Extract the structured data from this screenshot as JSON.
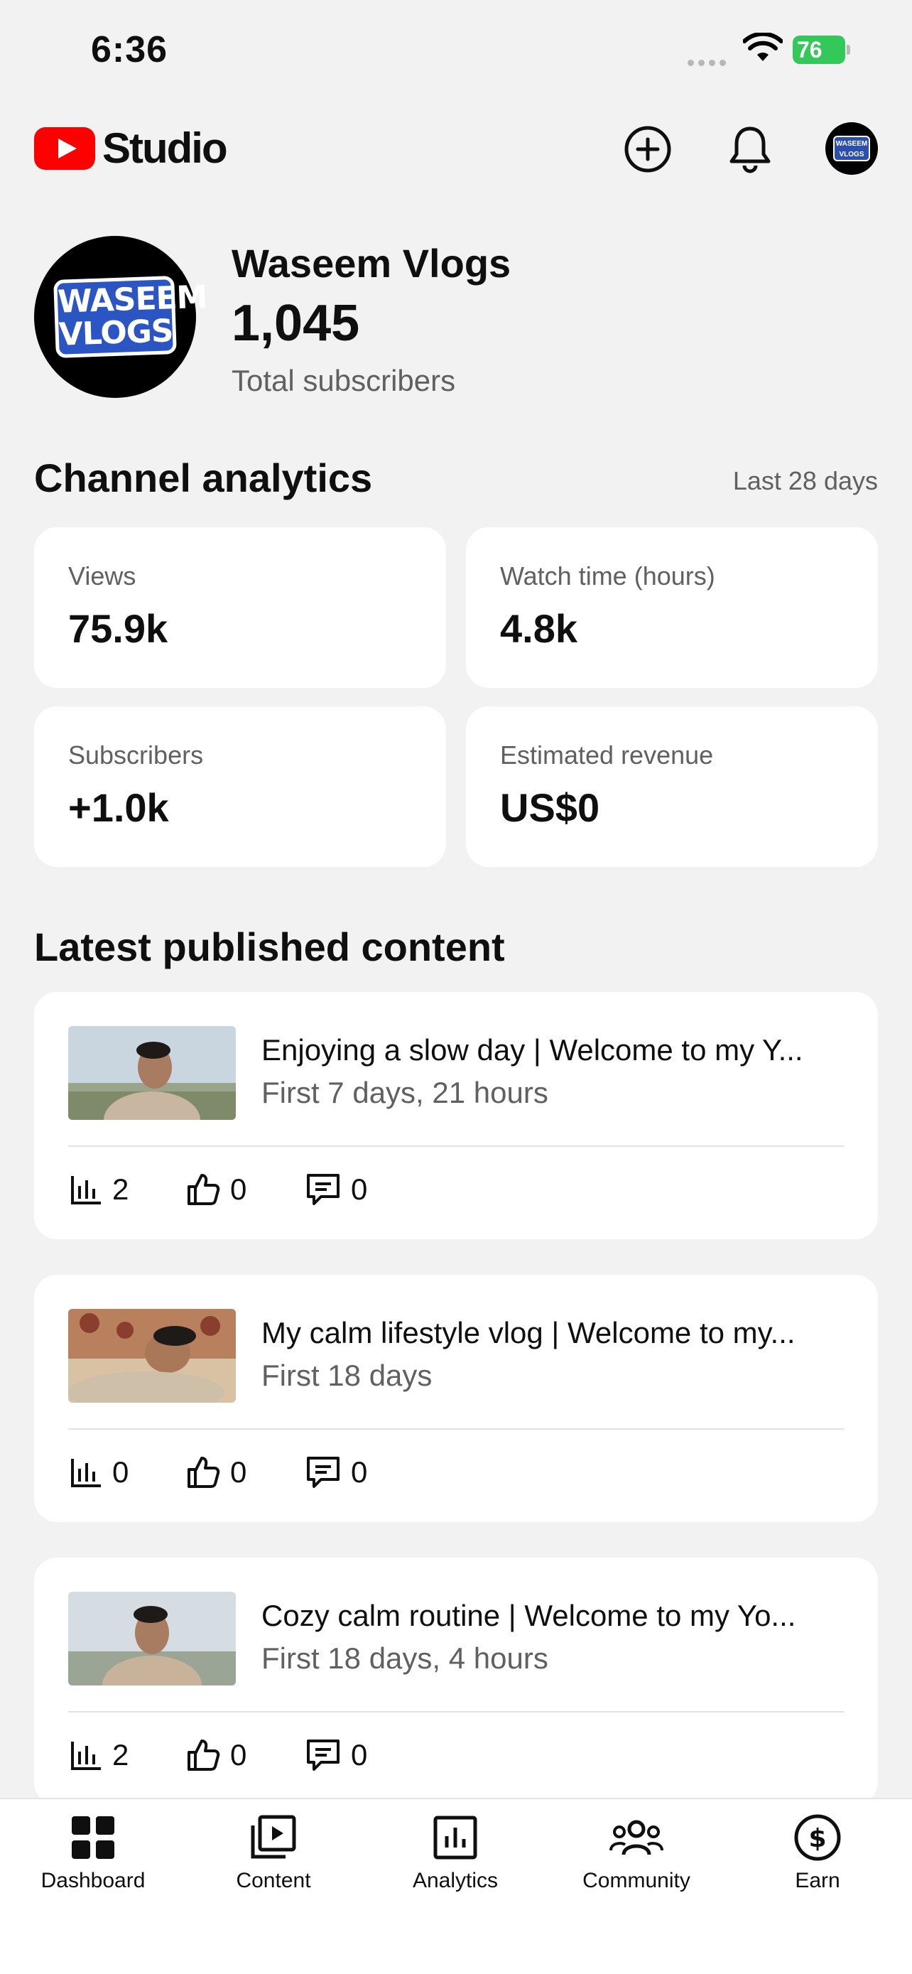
{
  "status": {
    "time": "6:36",
    "battery": "76"
  },
  "header": {
    "logo_text": "Studio",
    "avatar_text": "WASEEM VLOGS"
  },
  "channel": {
    "name": "Waseem Vlogs",
    "subscriber_count": "1,045",
    "subscriber_label": "Total subscribers",
    "avatar_line1": "WASEEM",
    "avatar_line2": "VLOGS"
  },
  "analytics": {
    "title": "Channel analytics",
    "range": "Last 28 days",
    "cards": [
      {
        "label": "Views",
        "value": "75.9k"
      },
      {
        "label": "Watch time (hours)",
        "value": "4.8k"
      },
      {
        "label": "Subscribers",
        "value": "+1.0k"
      },
      {
        "label": "Estimated revenue",
        "value": "US$0"
      }
    ]
  },
  "latest": {
    "title": "Latest published content",
    "items": [
      {
        "title": "Enjoying a slow day | Welcome to my Y...",
        "subtitle": "First 7 days, 21 hours",
        "views": "2",
        "likes": "0",
        "comments": "0"
      },
      {
        "title": "My calm lifestyle vlog | Welcome to my...",
        "subtitle": "First 18 days",
        "views": "0",
        "likes": "0",
        "comments": "0"
      },
      {
        "title": "Cozy calm routine | Welcome to my Yo...",
        "subtitle": "First 18 days, 4 hours",
        "views": "2",
        "likes": "0",
        "comments": "0"
      }
    ]
  },
  "nav": [
    {
      "label": "Dashboard",
      "icon": "dashboard-icon"
    },
    {
      "label": "Content",
      "icon": "content-icon"
    },
    {
      "label": "Analytics",
      "icon": "analytics-icon"
    },
    {
      "label": "Community",
      "icon": "community-icon"
    },
    {
      "label": "Earn",
      "icon": "earn-icon"
    }
  ]
}
